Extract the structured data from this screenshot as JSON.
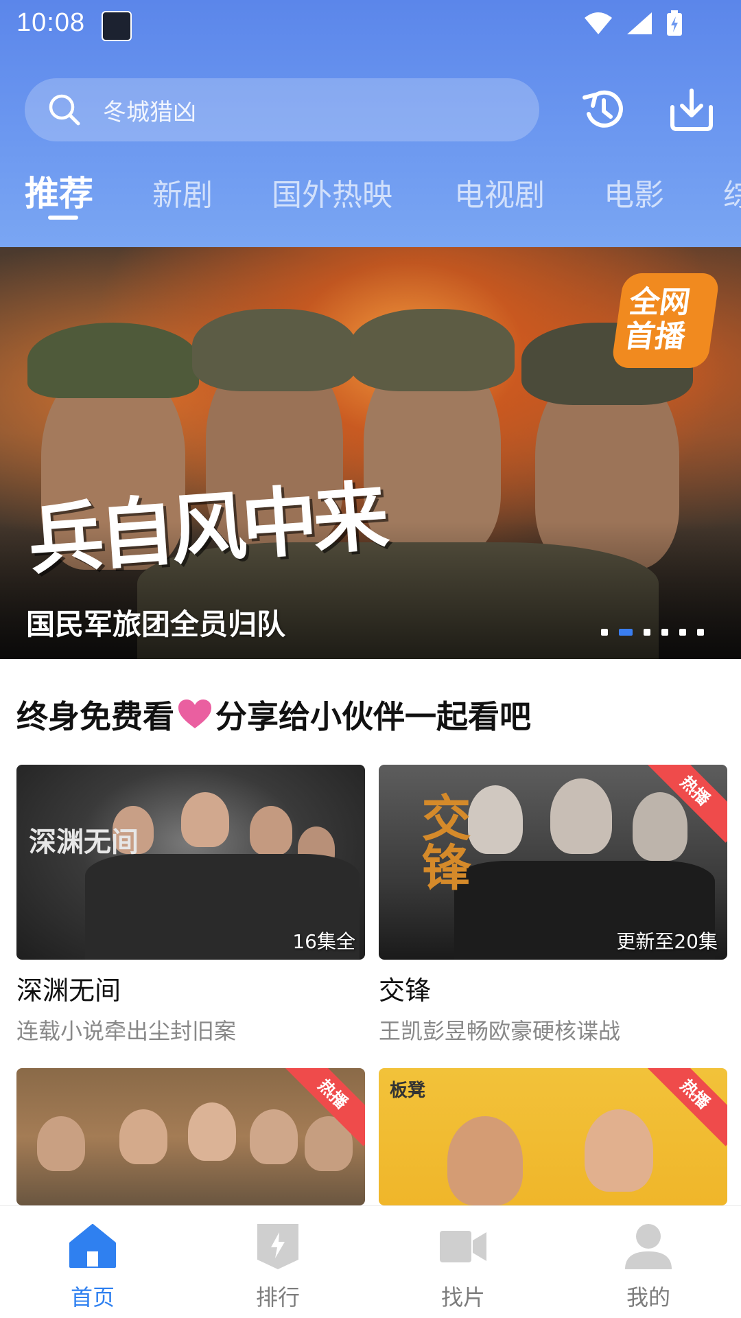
{
  "status_bar": {
    "time": "10:08"
  },
  "search": {
    "placeholder": "冬城猎凶"
  },
  "tabs": [
    {
      "label": "推荐",
      "active": true
    },
    {
      "label": "新剧"
    },
    {
      "label": "国外热映"
    },
    {
      "label": "电视剧"
    },
    {
      "label": "电影"
    },
    {
      "label": "综"
    }
  ],
  "banner": {
    "title_art": "兵自风中来",
    "badge": "全网首播",
    "caption": "国民军旅团全员归队",
    "dots_count": 6,
    "active_dot": 1
  },
  "section": {
    "title_part1": "终身免费看",
    "title_part2": "分享给小伙伴一起看吧"
  },
  "cards": [
    {
      "title": "深渊无间",
      "subtitle": "连载小说牵出尘封旧案",
      "episodes": "16集全",
      "hot": false,
      "art_title": "深渊无间"
    },
    {
      "title": "交锋",
      "subtitle": "王凯彭昱畅欧豪硬核谍战",
      "episodes": "更新至20集",
      "hot": true,
      "hot_label": "热播",
      "art_title": "交锋"
    },
    {
      "title": "",
      "subtitle": "",
      "episodes": "",
      "hot": true,
      "hot_label": "热播"
    },
    {
      "title": "",
      "subtitle": "",
      "episodes": "",
      "hot": true,
      "hot_label": "热播",
      "art_title": "板凳"
    }
  ],
  "bottom_nav": [
    {
      "label": "首页",
      "icon": "home-icon",
      "active": true
    },
    {
      "label": "排行",
      "icon": "ranking-icon"
    },
    {
      "label": "找片",
      "icon": "video-camera-icon"
    },
    {
      "label": "我的",
      "icon": "user-icon"
    }
  ],
  "colors": {
    "accent": "#2f80f0",
    "header": "#6c98f0",
    "hot": "#ef4b4b",
    "heart": "#ea5fa0"
  }
}
